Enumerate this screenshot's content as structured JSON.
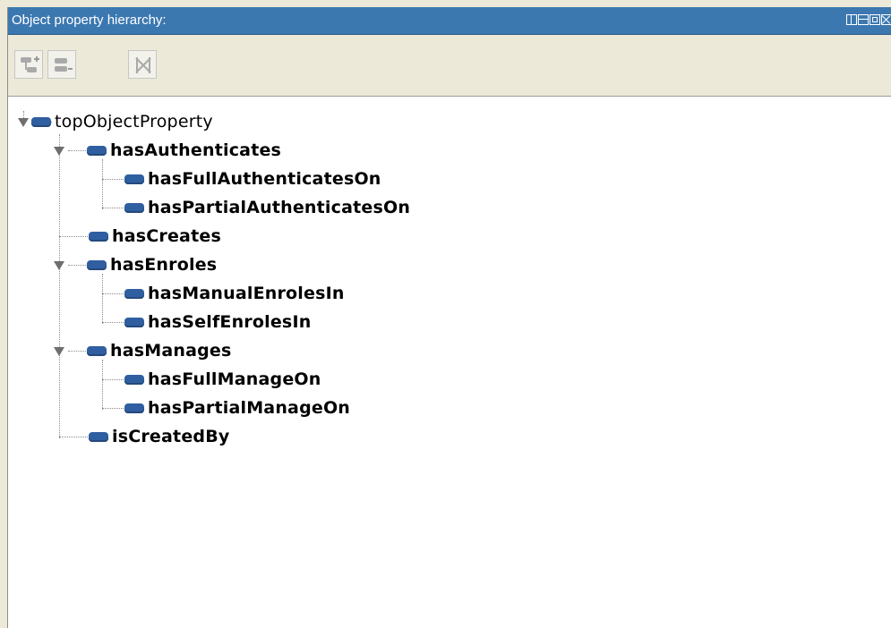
{
  "panel": {
    "title": "Object property hierarchy:"
  },
  "window_controls": [
    "split-view-icon",
    "horizontal-split-icon",
    "maximize-icon",
    "close-icon"
  ],
  "toolbar": {
    "buttons": [
      {
        "name": "add-sub-property-button",
        "icon": "add-subproperty-icon"
      },
      {
        "name": "add-sibling-property-button",
        "icon": "add-sibling-icon"
      },
      {
        "name": "delete-property-button",
        "icon": "delete-icon"
      }
    ]
  },
  "tree": {
    "root": "topObjectProperty",
    "nodes": [
      {
        "label": "topObjectProperty",
        "level": 0,
        "expanded": true
      },
      {
        "label": "hasAuthenticates",
        "level": 1,
        "expanded": true
      },
      {
        "label": "hasFullAuthenticatesOn",
        "level": 2
      },
      {
        "label": "hasPartialAuthenticatesOn",
        "level": 2
      },
      {
        "label": "hasCreates",
        "level": 1
      },
      {
        "label": "hasEnroles",
        "level": 1,
        "expanded": true
      },
      {
        "label": "hasManualEnrolesIn",
        "level": 2
      },
      {
        "label": "hasSelfEnrolesIn",
        "level": 2
      },
      {
        "label": "hasManages",
        "level": 1,
        "expanded": true
      },
      {
        "label": "hasFullManageOn",
        "level": 2
      },
      {
        "label": "hasPartialManageOn",
        "level": 2
      },
      {
        "label": "isCreatedBy",
        "level": 1
      }
    ]
  },
  "colors": {
    "titlebar": "#3c78b0",
    "property_icon": "#2f5fa0",
    "toolbar_bg": "#ece9d8"
  }
}
